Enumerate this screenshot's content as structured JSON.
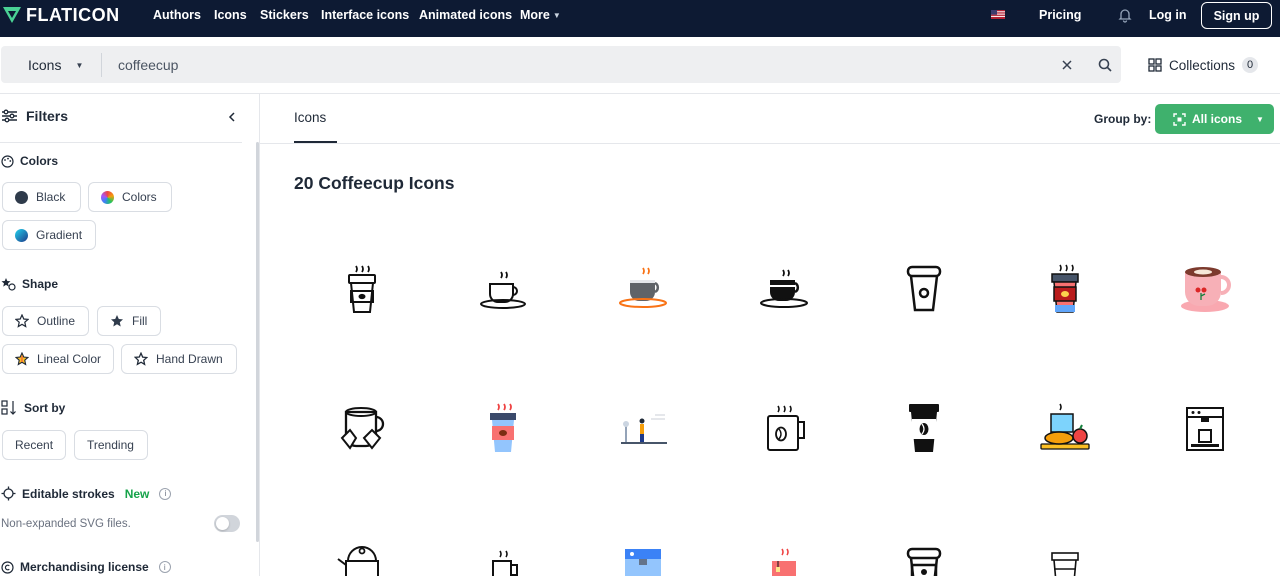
{
  "brand": {
    "name": "FLATICON"
  },
  "nav": {
    "links": [
      "Authors",
      "Icons",
      "Stickers",
      "Interface icons",
      "Animated icons"
    ],
    "more": "More",
    "pricing": "Pricing",
    "login": "Log in",
    "signup": "Sign up"
  },
  "search": {
    "type": "Icons",
    "query": "coffeecup"
  },
  "collections": {
    "label": "Collections",
    "count": "0"
  },
  "sidebar": {
    "title": "Filters",
    "colors_title": "Colors",
    "colors": [
      "Black",
      "Colors",
      "Gradient"
    ],
    "shape_title": "Shape",
    "shapes": [
      "Outline",
      "Fill",
      "Lineal Color",
      "Hand Drawn"
    ],
    "sort_title": "Sort by",
    "sort": [
      "Recent",
      "Trending"
    ],
    "editable_title": "Editable strokes",
    "editable_new": "New",
    "editable_note": "Non-expanded SVG files.",
    "merch_title": "Merchandising license"
  },
  "main": {
    "tab": "Icons",
    "group_by": "Group by:",
    "group_value": "All icons",
    "results_title": "20 Coffeecup Icons"
  },
  "icons": [
    "takeaway-cup-outline-icon",
    "coffee-cup-saucer-outline-icon",
    "coffee-cup-gray-icon",
    "coffee-cup-black-icon",
    "takeaway-cup-line-icon",
    "takeaway-cup-color-icon",
    "pink-cup-icon",
    "hand-drawn-mug-icon",
    "takeaway-cup-flat-icon",
    "coffee-scene-icon",
    "mug-bean-outline-icon",
    "takeaway-cup-bean-icon",
    "breakfast-tray-icon",
    "espresso-machine-icon",
    "teapot-outline-icon",
    "mug-small-outline-icon",
    "coffee-machine-color-icon",
    "tea-cup-color-icon",
    "takeaway-cup-bold-icon",
    "takeaway-cup-thin-icon"
  ],
  "colors": {
    "topbar": "#0d1a33",
    "accent": "#3fb16d",
    "new": "#16a34a"
  }
}
